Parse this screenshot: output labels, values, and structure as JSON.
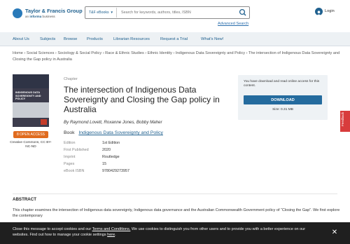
{
  "header": {
    "logo_title": "Taylor & Francis Group",
    "logo_sub_prefix": "an",
    "logo_sub_brand": "informa",
    "logo_sub_suffix": "business",
    "search_scope": "T&F eBooks",
    "search_placeholder": "Search for keywords, authors, titles, ISBN",
    "advanced_search": "Advanced Search",
    "login_label": "Login"
  },
  "nav": {
    "items": [
      "About Us",
      "Subjects",
      "Browse",
      "Products",
      "Librarian Resources",
      "Request a Trial",
      "What's New!"
    ]
  },
  "breadcrumb": "Home › Social Sciences › Sociology & Social Policy › Race & Ethnic Studies › Ethnic Identity › Indigenous Data Sovereignty and Policy › The intersection of Indigenous Data Sovereignty and Closing the Gap policy in Australia",
  "cover": {
    "title": "INDIGENOUS DATA SOVEREIGNTY AND POLICY"
  },
  "open_access_label": "8 OPEN ACCESS",
  "license": "Creative Commons, CC BY-NC-ND",
  "chapter": {
    "label": "Chapter",
    "title": "The intersection of Indigenous Data Sovereignty and Closing the Gap policy in Australia",
    "authors": "By Raymond Lovett, Roxanne Jones, Bobby Maher",
    "book_key": "Book",
    "book_title": "Indigenous Data Sovereignty and Policy"
  },
  "meta": [
    {
      "key": "Edition",
      "value": "1st Edition"
    },
    {
      "key": "First Published",
      "value": "2020"
    },
    {
      "key": "Imprint",
      "value": "Routledge"
    },
    {
      "key": "Pages",
      "value": "15"
    },
    {
      "key": "eBook ISBN",
      "value": "9780429273957"
    }
  ],
  "download": {
    "text": "You have download and read online access for this content.",
    "button": "DOWNLOAD",
    "size": "Size: 0.31 MB"
  },
  "feedback_label": "Feedback",
  "abstract": {
    "heading": "ABSTRACT",
    "text": "This chapter examines the intersection of Indigenous data sovereignty, Indigenous data governance and the Australian Commonwealth Government policy of “Closing the Gap”. We first explore the contemporary"
  },
  "cookie": {
    "part1": "Close this message to accept cookies and our ",
    "terms_link": "Terms and Conditions.",
    "part2": " We use cookies to distinguish you from other users and to provide you with a better experience on our websites. Find out how to manage your cookie settings ",
    "here_link": "here",
    "part3": "."
  },
  "colors": {
    "brand_blue": "#20618f",
    "download_button": "#246b9e",
    "open_access_orange": "#e06b1e",
    "feedback_red": "#d83c3c",
    "cookie_bg": "#1f1f1f"
  },
  "icons": [
    "search-icon",
    "user-icon",
    "close-icon",
    "chevron-down-icon"
  ]
}
